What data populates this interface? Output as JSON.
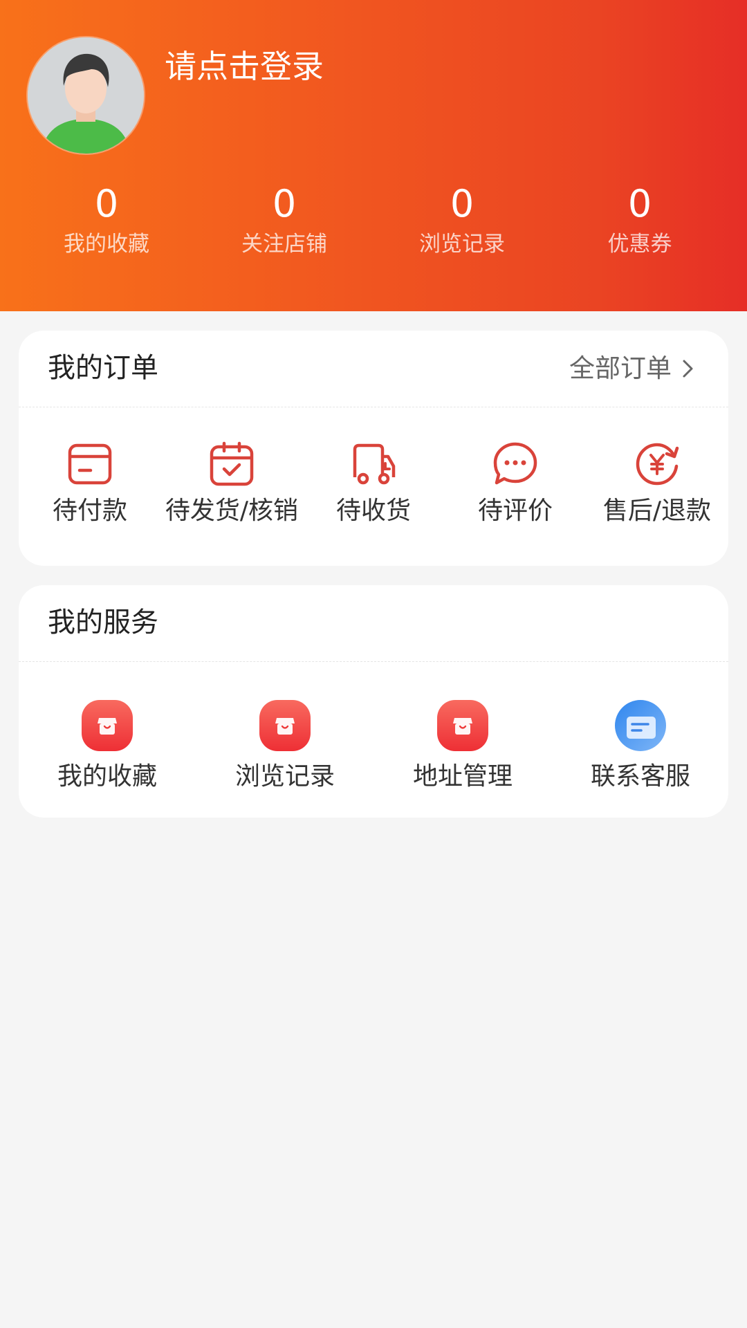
{
  "header": {
    "login_text": "请点击登录",
    "stats": [
      {
        "value": "0",
        "label": "我的收藏"
      },
      {
        "value": "0",
        "label": "关注店铺"
      },
      {
        "value": "0",
        "label": "浏览记录"
      },
      {
        "value": "0",
        "label": "优惠券"
      }
    ]
  },
  "orders": {
    "title": "我的订单",
    "all_label": "全部订单",
    "items": [
      {
        "label": "待付款",
        "icon": "wallet-icon"
      },
      {
        "label": "待发货/核销",
        "icon": "calendar-check-icon"
      },
      {
        "label": "待收货",
        "icon": "delivery-truck-icon"
      },
      {
        "label": "待评价",
        "icon": "chat-bubble-icon"
      },
      {
        "label": "售后/退款",
        "icon": "refund-yen-icon"
      }
    ]
  },
  "services": {
    "title": "我的服务",
    "items": [
      {
        "label": "我的收藏",
        "icon": "store-icon"
      },
      {
        "label": "浏览记录",
        "icon": "store-icon"
      },
      {
        "label": "地址管理",
        "icon": "store-icon"
      },
      {
        "label": "联系客服",
        "icon": "customer-service-icon"
      }
    ]
  },
  "colors": {
    "accent": "#f25a1f",
    "icon_red": "#d9433a",
    "service_red": "#f0393b",
    "service_blue": "#3d8ef0"
  }
}
